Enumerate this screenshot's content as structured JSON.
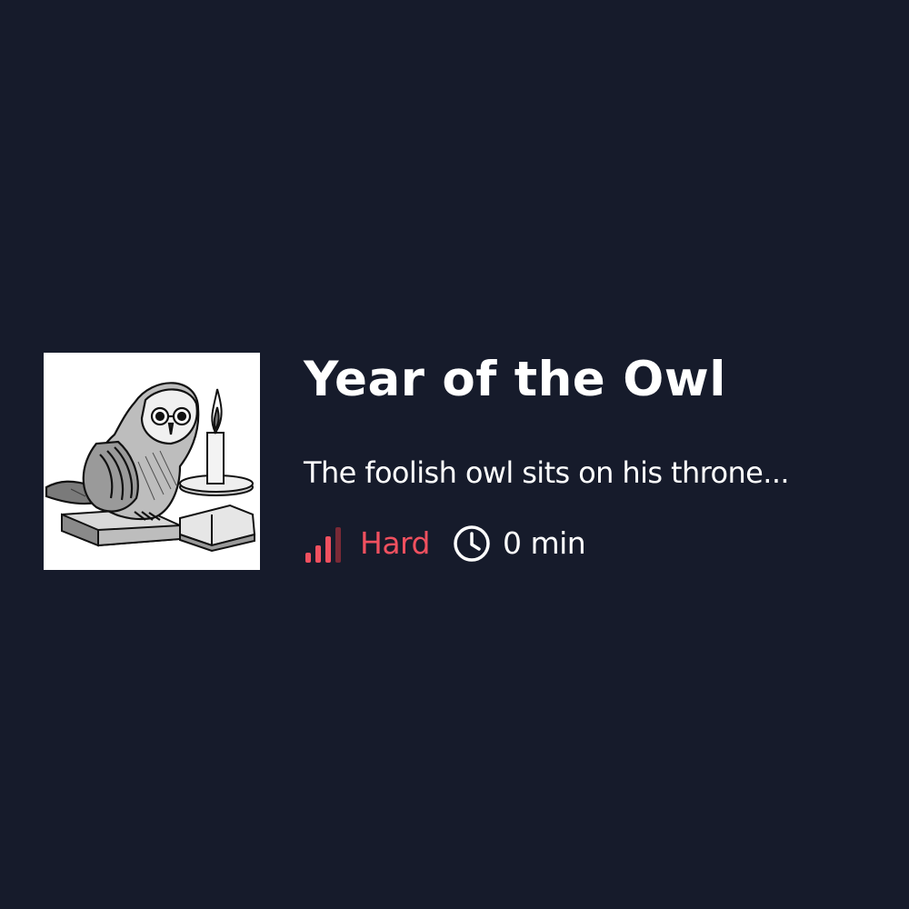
{
  "card": {
    "title": "Year of the Owl",
    "description": "The foolish owl sits on his throne...",
    "thumbnail_icon": "owl-engraving-illustration",
    "difficulty": {
      "label": "Hard",
      "icon": "signal-bars-icon",
      "level": 3,
      "max_level": 4,
      "color": "#f0505f",
      "inactive_color": "#7a2a36"
    },
    "duration": {
      "label": "0 min",
      "icon": "clock-icon"
    }
  },
  "colors": {
    "background": "#161b2b",
    "text": "#ffffff"
  }
}
